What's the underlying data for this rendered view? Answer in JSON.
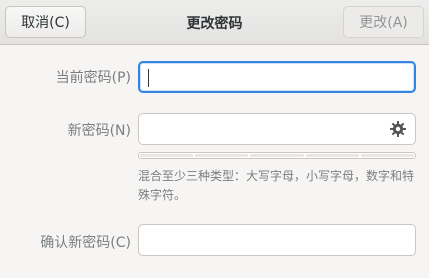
{
  "headerbar": {
    "cancel_label": "取消(C)",
    "title": "更改密码",
    "change_label": "更改(A)"
  },
  "form": {
    "current_password_label": "当前密码(P)",
    "current_password_value": "",
    "new_password_label": "新密码(N)",
    "new_password_value": "",
    "confirm_password_label": "确认新密码(C)",
    "confirm_password_value": "",
    "hint": "混合至少三种类型：大写字母，小写字母，数字和特殊字符。",
    "strength_segments": 5,
    "strength_level": 0
  },
  "colors": {
    "accent": "#3584e4",
    "window_bg": "#f6f5f4"
  },
  "icons": {
    "generate_password": "gear-icon"
  }
}
